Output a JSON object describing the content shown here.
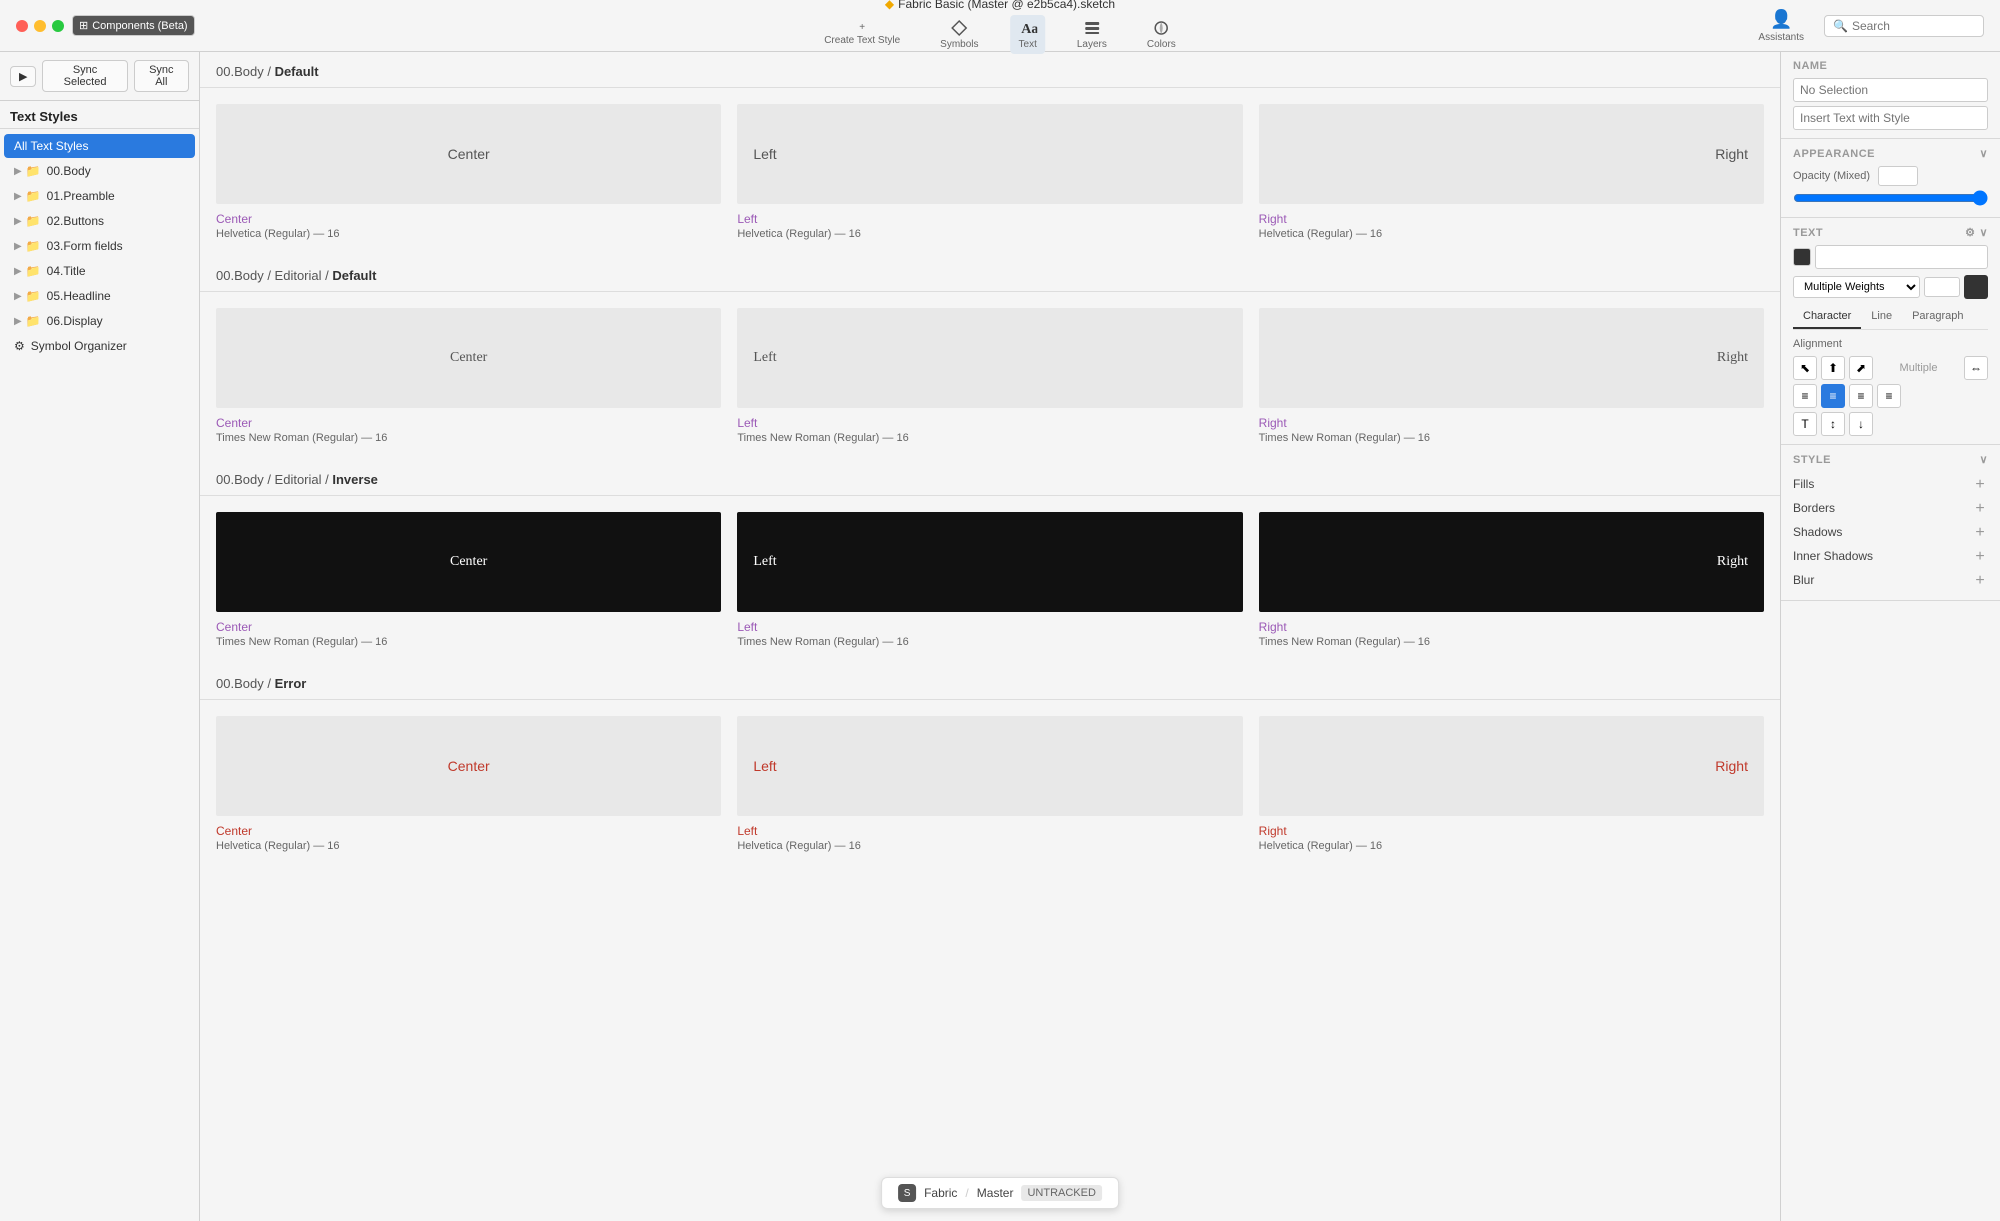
{
  "titlebar": {
    "title": "Fabric Basic (Master @ e2b5ca4).sketch",
    "title_icon": "◆",
    "traffic_lights": [
      "red",
      "yellow",
      "green"
    ]
  },
  "toolbar": {
    "create_text_style_label": "Create Text Style",
    "symbols_label": "Symbols",
    "text_label": "Text",
    "layers_label": "Layers",
    "colors_label": "Colors",
    "assistants_label": "Assistants",
    "search_placeholder": "Search"
  },
  "left_sidebar": {
    "components_beta_label": "Components (Beta)",
    "sync_selected_label": "Sync Selected",
    "sync_all_label": "Sync All",
    "section_title": "Text Styles",
    "all_text_styles_label": "All Text Styles",
    "items": [
      {
        "id": "00body",
        "label": "00.Body",
        "icon": "folder"
      },
      {
        "id": "01preamble",
        "label": "01.Preamble",
        "icon": "folder"
      },
      {
        "id": "02buttons",
        "label": "02.Buttons",
        "icon": "folder"
      },
      {
        "id": "03formfields",
        "label": "03.Form fields",
        "icon": "folder"
      },
      {
        "id": "04title",
        "label": "04.Title",
        "icon": "folder"
      },
      {
        "id": "05headline",
        "label": "05.Headline",
        "icon": "folder"
      },
      {
        "id": "06display",
        "label": "06.Display",
        "icon": "folder"
      },
      {
        "id": "symbolorganizer",
        "label": "Symbol Organizer",
        "icon": "plugin"
      }
    ]
  },
  "main": {
    "sections": [
      {
        "id": "default",
        "breadcrumb": "00.Body",
        "breadcrumb_separator": "/",
        "name": "Default",
        "styles": [
          {
            "id": "center1",
            "label": "Center",
            "font_info": "Helvetica (Regular) — 16",
            "alignment": "center",
            "dark": false,
            "error": false
          },
          {
            "id": "left1",
            "label": "Left",
            "font_info": "Helvetica (Regular) — 16",
            "alignment": "left",
            "dark": false,
            "error": false
          },
          {
            "id": "right1",
            "label": "Right",
            "font_info": "Helvetica (Regular) — 16",
            "alignment": "right",
            "dark": false,
            "error": false
          }
        ]
      },
      {
        "id": "editorial-default",
        "breadcrumb": "00.Body / Editorial",
        "breadcrumb_separator": "/",
        "name": "Default",
        "styles": [
          {
            "id": "center2",
            "label": "Center",
            "font_info": "Times New Roman (Regular) — 16",
            "alignment": "center",
            "dark": false,
            "error": false
          },
          {
            "id": "left2",
            "label": "Left",
            "font_info": "Times New Roman (Regular) — 16",
            "alignment": "left",
            "dark": false,
            "error": false
          },
          {
            "id": "right2",
            "label": "Right",
            "font_info": "Times New Roman (Regular) — 16",
            "alignment": "right",
            "dark": false,
            "error": false
          }
        ]
      },
      {
        "id": "editorial-inverse",
        "breadcrumb": "00.Body / Editorial",
        "breadcrumb_separator": "/",
        "name": "Inverse",
        "styles": [
          {
            "id": "center3",
            "label": "Center",
            "font_info": "Times New Roman (Regular) — 16",
            "alignment": "center",
            "dark": true,
            "error": false
          },
          {
            "id": "left3",
            "label": "Left",
            "font_info": "Times New Roman (Regular) — 16",
            "alignment": "left",
            "dark": true,
            "error": false
          },
          {
            "id": "right3",
            "label": "Right",
            "font_info": "Times New Roman (Regular) — 16",
            "alignment": "right",
            "dark": true,
            "error": false
          }
        ]
      },
      {
        "id": "error",
        "breadcrumb": "00.Body",
        "breadcrumb_separator": "/",
        "name": "Error",
        "styles": [
          {
            "id": "center4",
            "label": "Center",
            "font_info": "Helvetica (Regular) — 16",
            "alignment": "center",
            "dark": false,
            "error": true
          },
          {
            "id": "left4",
            "label": "Left",
            "font_info": "Helvetica (Regular) — 16",
            "alignment": "left",
            "dark": false,
            "error": true
          },
          {
            "id": "right4",
            "label": "Right",
            "font_info": "Helvetica (Regular) — 16",
            "alignment": "right",
            "dark": false,
            "error": true
          }
        ]
      }
    ]
  },
  "right_sidebar": {
    "name_label": "NAME",
    "name_placeholder": "No Selection",
    "style_placeholder": "Insert Text with Style",
    "appearance_label": "APPEARANCE",
    "opacity_label": "Opacity (Mixed)",
    "opacity_value": "",
    "text_label": "TEXT",
    "color_label": "",
    "font_dropdown_label": "Multiple Weights",
    "tabs": [
      "Character",
      "Line",
      "Paragraph"
    ],
    "active_tab": "Character",
    "alignment_label": "Alignment",
    "multiple_label": "Multiple",
    "align_buttons": [
      "left-align",
      "center-align",
      "right-align",
      "justify-align"
    ],
    "style_label": "STYLE",
    "fills_label": "Fills",
    "borders_label": "Borders",
    "shadows_label": "Shadows",
    "inner_shadows_label": "Inner Shadows",
    "blur_label": "Blur"
  },
  "bottom_bar": {
    "logo_text": "S",
    "fabric_label": "Fabric",
    "separator": "/",
    "master_label": "Master",
    "untracked_label": "UNTRACKED"
  }
}
